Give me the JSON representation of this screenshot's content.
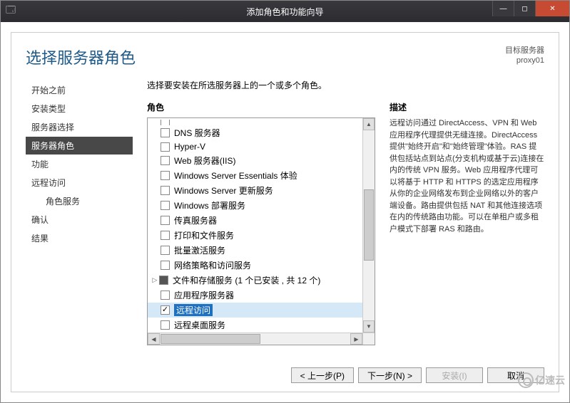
{
  "titlebar": {
    "title": "添加角色和功能向导"
  },
  "header": {
    "page_title": "选择服务器角色",
    "server_label": "目标服务器",
    "server_name": "proxy01"
  },
  "sidebar": {
    "items": [
      {
        "label": "开始之前",
        "active": false
      },
      {
        "label": "安装类型",
        "active": false
      },
      {
        "label": "服务器选择",
        "active": false
      },
      {
        "label": "服务器角色",
        "active": true
      },
      {
        "label": "功能",
        "active": false
      },
      {
        "label": "远程访问",
        "active": false
      },
      {
        "label": "角色服务",
        "active": false,
        "sub": true
      },
      {
        "label": "确认",
        "active": false
      },
      {
        "label": "结果",
        "active": false
      }
    ]
  },
  "instruction": "选择要安装在所选服务器上的一个或多个角色。",
  "columns": {
    "roles": "角色",
    "description": "描述"
  },
  "roles": [
    {
      "label": "DNS 服务器",
      "checked": false
    },
    {
      "label": "Hyper-V",
      "checked": false
    },
    {
      "label": "Web 服务器(IIS)",
      "checked": false
    },
    {
      "label": "Windows Server Essentials 体验",
      "checked": false
    },
    {
      "label": "Windows Server 更新服务",
      "checked": false
    },
    {
      "label": "Windows 部署服务",
      "checked": false
    },
    {
      "label": "传真服务器",
      "checked": false
    },
    {
      "label": "打印和文件服务",
      "checked": false
    },
    {
      "label": "批量激活服务",
      "checked": false
    },
    {
      "label": "网络策略和访问服务",
      "checked": false
    },
    {
      "label": "文件和存储服务 (1 个已安装 ,  共 12 个)",
      "checked": false,
      "partial": true,
      "expandable": true
    },
    {
      "label": "应用程序服务器",
      "checked": false
    },
    {
      "label": "远程访问",
      "checked": true,
      "selected": true
    },
    {
      "label": "远程桌面服务",
      "checked": false
    }
  ],
  "description_text": "远程访问通过 DirectAccess、VPN 和 Web 应用程序代理提供无缝连接。DirectAccess 提供\"始终开启\"和\"始终管理\"体验。RAS 提供包括站点到站点(分支机构或基于云)连接在内的传统 VPN 服务。Web 应用程序代理可以将基于 HTTP 和 HTTPS 的选定应用程序从你的企业网络发布到企业网络以外的客户端设备。路由提供包括 NAT 和其他连接选项在内的传统路由功能。可以在单租户或多租户模式下部署 RAS 和路由。",
  "buttons": {
    "prev": "< 上一步(P)",
    "next": "下一步(N) >",
    "install": "安装(I)",
    "cancel": "取消"
  },
  "watermark": "亿速云"
}
